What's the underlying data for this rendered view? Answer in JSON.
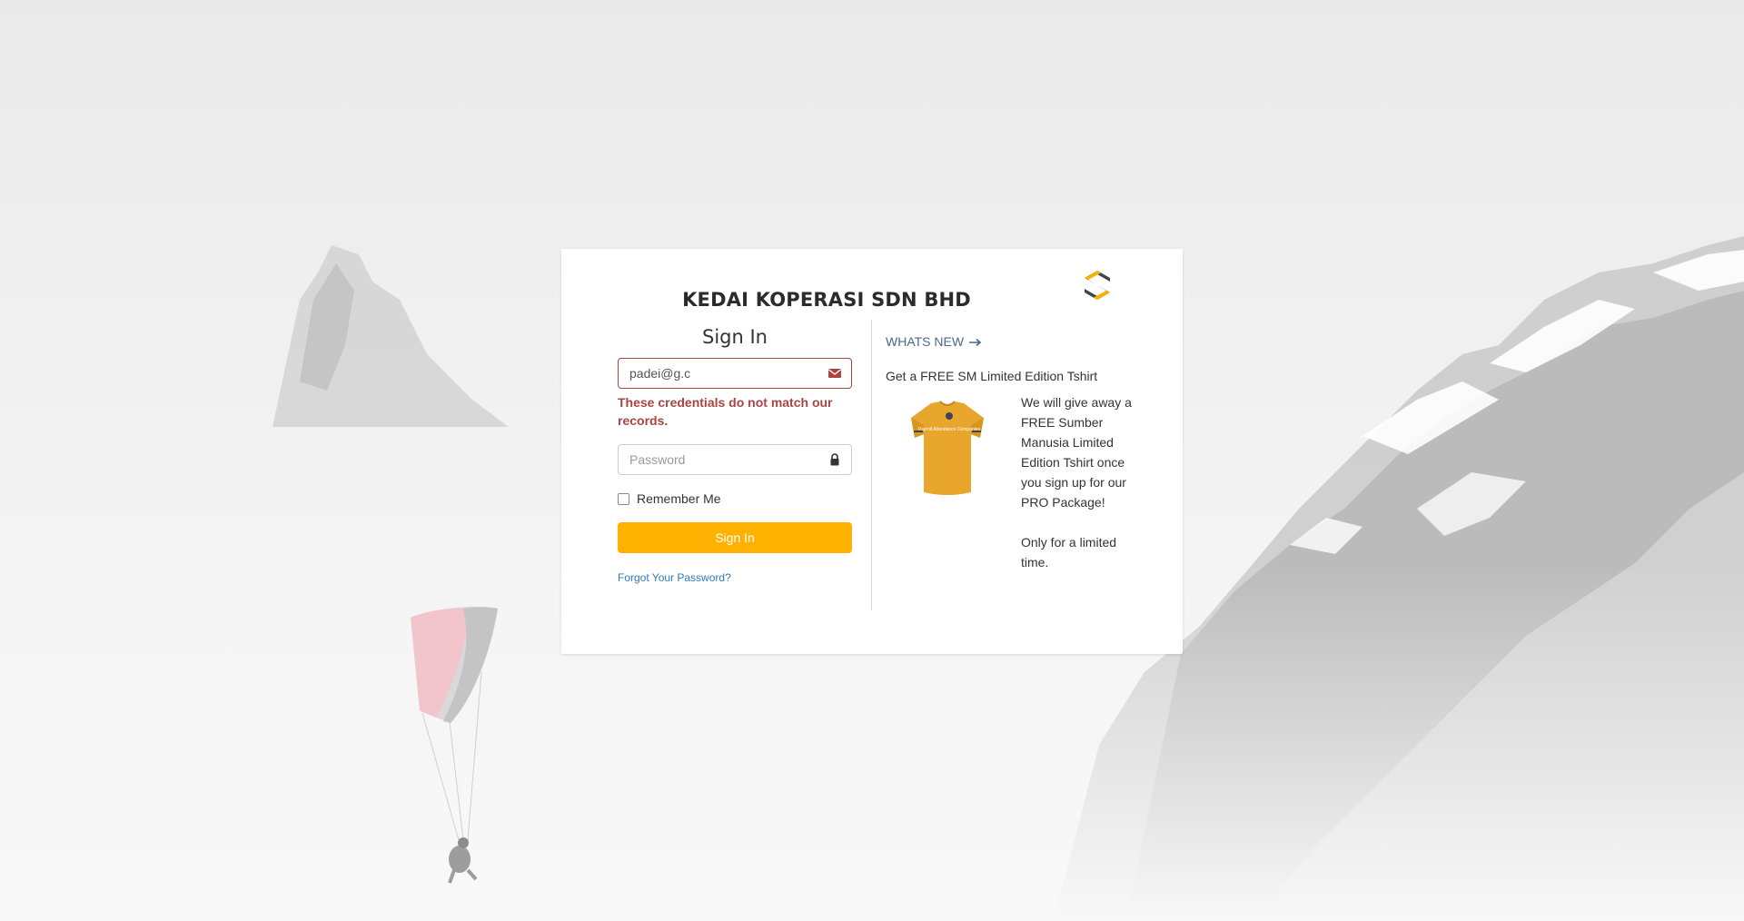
{
  "app": {
    "company_name": "KEDAI KOPERASI SDN BHD",
    "logo": "sumber-manusia-logo"
  },
  "login": {
    "title": "Sign In",
    "email_value": "padei@g.c",
    "email_icon": "envelope-icon",
    "error_message": "These credentials do not match our records.",
    "password_placeholder": "Password",
    "password_icon": "lock-icon",
    "remember_label": "Remember Me",
    "remember_checked": false,
    "signin_button": "Sign In",
    "forgot_link": "Forgot Your Password?"
  },
  "news": {
    "header": "WHATS NEW",
    "header_icon": "arrow-right-icon",
    "promo_title": "Get a FREE SM Limited Edition Tshirt",
    "promo_text": "We will give away a FREE Sumber Manusia Limited Edition Tshirt once you sign up for our PRO Package!\n\nOnly for a limited time.",
    "tshirt_text": "Payroll Attendance Companies"
  },
  "colors": {
    "accent": "#ffb100",
    "error": "#a94442",
    "link": "#337ab7",
    "logo_dark": "#3b4555",
    "logo_accent": "#f2b400",
    "tshirt": "#e8a62d"
  }
}
